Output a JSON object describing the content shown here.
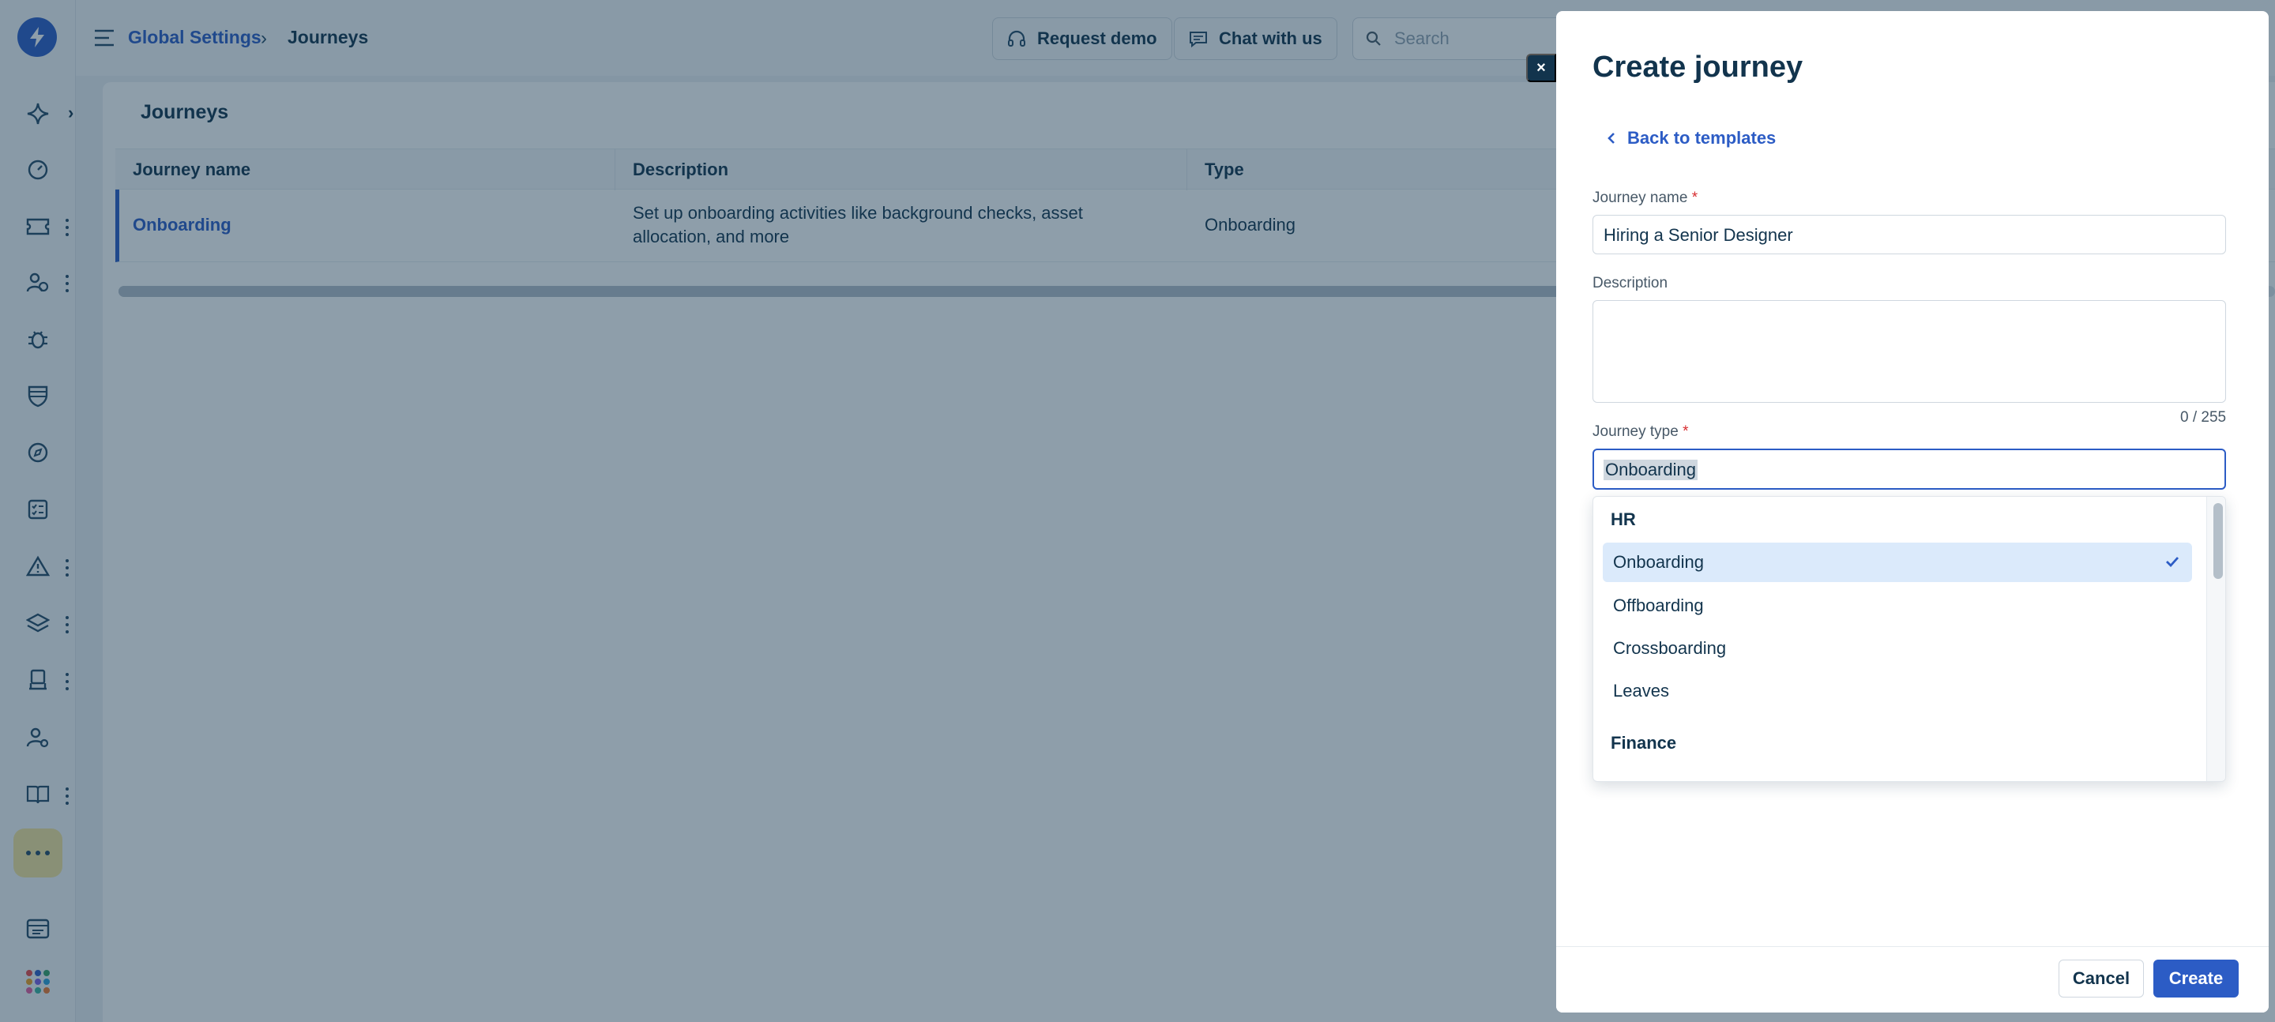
{
  "breadcrumb": {
    "parent": "Global Settings",
    "separator": "›",
    "current": "Journeys"
  },
  "header": {
    "request_demo": "Request demo",
    "chat_with_us": "Chat with us",
    "search_placeholder": "Search"
  },
  "page": {
    "title": "Journeys"
  },
  "table": {
    "columns": [
      "Journey name",
      "Description",
      "Type"
    ],
    "rows": [
      {
        "name": "Onboarding",
        "description_line1": "Set up onboarding activities like background checks, asset",
        "description_line2": "allocation, and more",
        "type": "Onboarding"
      }
    ]
  },
  "drawer": {
    "close": "×",
    "title": "Create journey",
    "back_link": "Back to templates",
    "journey_name_label": "Journey name",
    "required_mark": "*",
    "journey_name_value": "Hiring a Senior Designer",
    "description_label": "Description",
    "description_value": "",
    "counter": "0 / 255",
    "journey_type_label": "Journey type",
    "journey_type_value": "Onboarding",
    "dropdown": {
      "group_hr": "HR",
      "options": [
        "Onboarding",
        "Offboarding",
        "Crossboarding",
        "Leaves"
      ],
      "selected": "Onboarding",
      "group_finance": "Finance"
    },
    "cancel": "Cancel",
    "create": "Create"
  },
  "colors": {
    "brand": "#2c5cc5",
    "text": "#12344d",
    "selected_bg": "#dbeafb",
    "more_bg": "#f6e59b"
  }
}
